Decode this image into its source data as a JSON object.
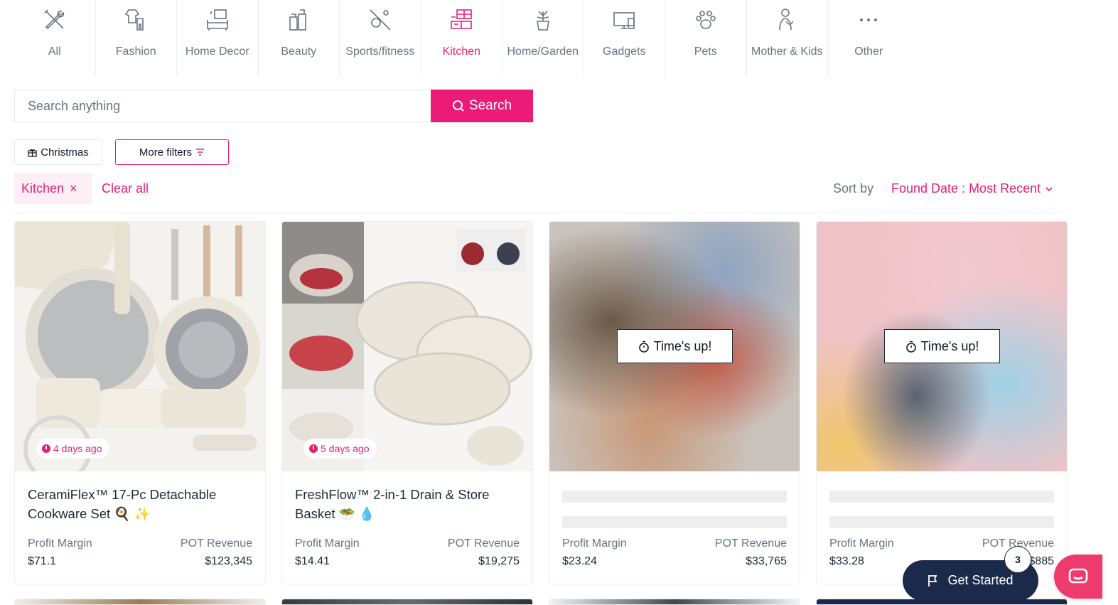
{
  "categories": [
    {
      "label": "All",
      "icon": "tools-icon",
      "active": false
    },
    {
      "label": "Fashion",
      "icon": "clothing-icon",
      "active": false
    },
    {
      "label": "Home Decor",
      "icon": "furniture-icon",
      "active": false
    },
    {
      "label": "Beauty",
      "icon": "cosmetics-icon",
      "active": false
    },
    {
      "label": "Sports/fitness",
      "icon": "sports-icon",
      "active": false
    },
    {
      "label": "Kitchen",
      "icon": "kitchen-icon",
      "active": true
    },
    {
      "label": "Home/Garden",
      "icon": "plant-icon",
      "active": false
    },
    {
      "label": "Gadgets",
      "icon": "devices-icon",
      "active": false
    },
    {
      "label": "Pets",
      "icon": "paw-icon",
      "active": false
    },
    {
      "label": "Mother & Kids",
      "icon": "mother-child-icon",
      "active": false
    },
    {
      "label": "Other",
      "icon": "more-dots-icon",
      "active": false
    }
  ],
  "search": {
    "placeholder": "Search anything",
    "value": "",
    "button_label": "Search"
  },
  "filters": {
    "christmas_label": "Christmas",
    "more_label": "More filters"
  },
  "active_filters": {
    "chip_label": "Kitchen",
    "chip_remove": "×",
    "clear_all_label": "Clear all"
  },
  "sort": {
    "label": "Sort by",
    "value": "Found Date : Most Recent"
  },
  "products": [
    {
      "title": "CeramiFlex™ 17-Pc Detachable Cookware Set 🍳 ✨",
      "found": "4 days ago",
      "margin_label": "Profit Margin",
      "margin": "$71.1",
      "revenue_label": "POT Revenue",
      "revenue": "$123,345",
      "locked": false
    },
    {
      "title": "FreshFlow™ 2-in-1 Drain & Store Basket 🥗 💧",
      "found": "5 days ago",
      "margin_label": "Profit Margin",
      "margin": "$14.41",
      "revenue_label": "POT Revenue",
      "revenue": "$19,275",
      "locked": false
    },
    {
      "title": "",
      "locked_label": "Time's up!",
      "margin_label": "Profit Margin",
      "margin": "$23.24",
      "revenue_label": "POT Revenue",
      "revenue": "$33,765",
      "locked": true
    },
    {
      "title": "",
      "locked_label": "Time's up!",
      "margin_label": "Profit Margin",
      "margin": "$33.28",
      "revenue_label": "POT Revenue",
      "revenue": "$885",
      "locked": true
    }
  ],
  "floating": {
    "get_started_label": "Get Started",
    "get_started_count": "3"
  },
  "colors": {
    "accent": "#ec1a77",
    "navy": "#1b2a4a",
    "chat": "#ef3a6e",
    "muted": "#6b7280"
  }
}
